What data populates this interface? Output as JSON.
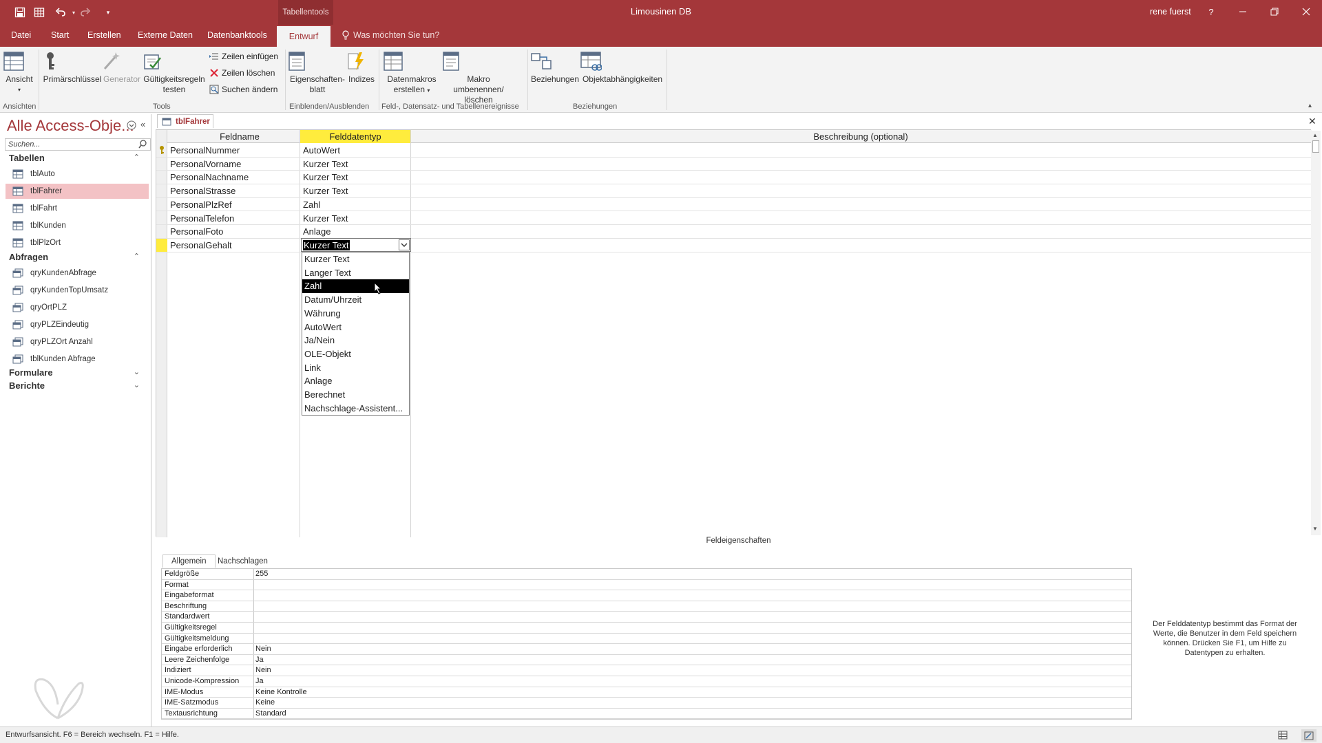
{
  "titlebar": {
    "context_tab": "Tabellentools",
    "app_title": "Limousinen DB",
    "user": "rene fuerst",
    "help": "?"
  },
  "ribbon_tabs": [
    "Datei",
    "Start",
    "Erstellen",
    "Externe Daten",
    "Datenbanktools",
    "Entwurf"
  ],
  "active_tab": "Entwurf",
  "tell_me": "Was möchten Sie tun?",
  "ribbon": {
    "ansicht": "Ansicht",
    "primaerschluessel": "Primärschlüssel",
    "generator": "Generator",
    "gueltigkeit_1": "Gültigkeitsregeln",
    "gueltigkeit_2": "testen",
    "zeilen_einfuegen": "Zeilen einfügen",
    "zeilen_loeschen": "Zeilen löschen",
    "suchen_aendern": "Suchen ändern",
    "eigenschaften_1": "Eigenschaften-",
    "eigenschaften_2": "blatt",
    "indizes": "Indizes",
    "datenmakros_1": "Datenmakros",
    "datenmakros_2": "erstellen",
    "makro_1": "Makro umbenennen/",
    "makro_2": "löschen",
    "beziehungen": "Beziehungen",
    "objektabh": "Objektabhängigkeiten",
    "groups": {
      "ansichten": "Ansichten",
      "tools": "Tools",
      "einblenden": "Einblenden/Ausblenden",
      "ereignisse": "Feld-, Datensatz- und Tabellenereignisse",
      "beziehungen": "Beziehungen"
    }
  },
  "nav": {
    "title": "Alle Access-Obje...",
    "search_placeholder": "Suchen...",
    "sections": {
      "tabellen": "Tabellen",
      "abfragen": "Abfragen",
      "formulare": "Formulare",
      "berichte": "Berichte"
    },
    "tables": [
      "tblAuto",
      "tblFahrer",
      "tblFahrt",
      "tblKunden",
      "tblPlzOrt"
    ],
    "selected_table": "tblFahrer",
    "queries": [
      "qryKundenAbfrage",
      "qryKundenTopUmsatz",
      "qryOrtPLZ",
      "qryPLZEindeutig",
      "qryPLZOrt Anzahl",
      "tblKunden Abfrage"
    ]
  },
  "doc_tab": "tblFahrer",
  "grid": {
    "headers": [
      "Feldname",
      "Felddatentyp",
      "Beschreibung (optional)"
    ],
    "rows": [
      {
        "name": "PersonalNummer",
        "type": "AutoWert"
      },
      {
        "name": "PersonalVorname",
        "type": "Kurzer Text"
      },
      {
        "name": "PersonalNachname",
        "type": "Kurzer Text"
      },
      {
        "name": "PersonalStrasse",
        "type": "Kurzer Text"
      },
      {
        "name": "PersonalPlzRef",
        "type": "Zahl"
      },
      {
        "name": "PersonalTelefon",
        "type": "Kurzer Text"
      },
      {
        "name": "PersonalFoto",
        "type": "Anlage"
      },
      {
        "name": "PersonalGehalt",
        "type": "Kurzer Text"
      }
    ]
  },
  "dropdown": {
    "value": "Kurzer Text",
    "options": [
      "Kurzer Text",
      "Langer Text",
      "Zahl",
      "Datum/Uhrzeit",
      "Währung",
      "AutoWert",
      "Ja/Nein",
      "OLE-Objekt",
      "Link",
      "Anlage",
      "Berechnet",
      "Nachschlage-Assistent..."
    ],
    "highlighted": "Zahl"
  },
  "properties": {
    "caption": "Feldeigenschaften",
    "tabs": [
      "Allgemein",
      "Nachschlagen"
    ],
    "rows": [
      {
        "label": "Feldgröße",
        "value": "255"
      },
      {
        "label": "Format",
        "value": ""
      },
      {
        "label": "Eingabeformat",
        "value": ""
      },
      {
        "label": "Beschriftung",
        "value": ""
      },
      {
        "label": "Standardwert",
        "value": ""
      },
      {
        "label": "Gültigkeitsregel",
        "value": ""
      },
      {
        "label": "Gültigkeitsmeldung",
        "value": ""
      },
      {
        "label": "Eingabe erforderlich",
        "value": "Nein"
      },
      {
        "label": "Leere Zeichenfolge",
        "value": "Ja"
      },
      {
        "label": "Indiziert",
        "value": "Nein"
      },
      {
        "label": "Unicode-Kompression",
        "value": "Ja"
      },
      {
        "label": "IME-Modus",
        "value": "Keine Kontrolle"
      },
      {
        "label": "IME-Satzmodus",
        "value": "Keine"
      },
      {
        "label": "Textausrichtung",
        "value": "Standard"
      }
    ],
    "help": "Der Felddatentyp bestimmt das Format der Werte, die Benutzer in dem Feld speichern können. Drücken Sie F1, um Hilfe zu Datentypen zu erhalten."
  },
  "status": "Entwurfsansicht. F6 = Bereich wechseln. F1 = Hilfe.",
  "colors": {
    "accent": "#a4373a",
    "selected_nav": "#f3c2c5",
    "header_highlight": "#ffec3d"
  }
}
